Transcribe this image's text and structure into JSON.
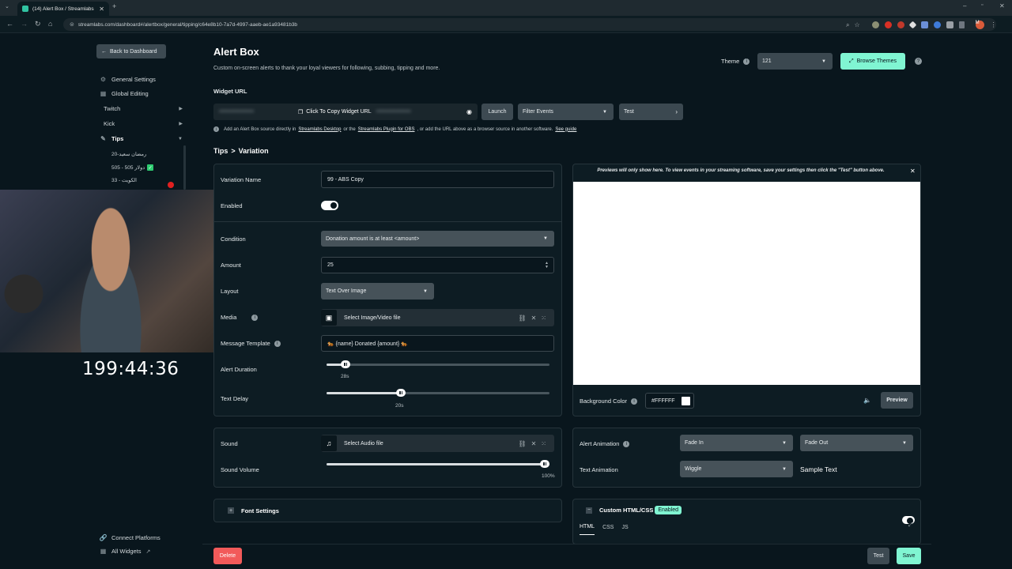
{
  "browser": {
    "tab_title": "(14) Alert Box / Streamlabs",
    "url": "streamlabs.com/dashboard#/alertbox/general/tipping/c64e8b10-7a7d-4997-aaeb-ae1a93481b3b",
    "profile_initial": "M"
  },
  "sidebar": {
    "back_label": "Back to Dashboard",
    "items": [
      {
        "label": "General Settings",
        "icon": "gear-icon"
      },
      {
        "label": "Global Editing",
        "icon": "grid-icon"
      },
      {
        "label": "Twitch"
      },
      {
        "label": "Kick"
      },
      {
        "label": "Tips",
        "icon": "coins-icon"
      }
    ],
    "tips_variations": [
      "20-رمضان سعيد",
      "505 - 505 دولار",
      "33 - الكويت"
    ],
    "bottom": [
      {
        "label": "Connect Platforms",
        "icon": "link-icon"
      },
      {
        "label": "All Widgets",
        "icon": "grid-icon"
      }
    ]
  },
  "webcam": {
    "timer": "199:44:36"
  },
  "header": {
    "title": "Alert Box",
    "subtitle": "Custom on-screen alerts to thank your loyal viewers for following, subbing, tipping and more.",
    "theme_label": "Theme",
    "theme_value": "121",
    "browse_themes": "Browse Themes"
  },
  "widget": {
    "url_label": "Widget URL",
    "copy_label": "Click To Copy Widget URL",
    "launch": "Launch",
    "filter_events": "Filter Events",
    "test": "Test",
    "info_parts": {
      "a": "Add an Alert Box source directly in",
      "b": "Streamlabs Desktop",
      "c": "or the",
      "d": "Streamlabs Plugin for OBS",
      "e": ", or add the URL above as a browser source in another software.",
      "f": "See guide"
    }
  },
  "breadcrumb": {
    "parent": "Tips",
    "sep": ">",
    "current": "Variation"
  },
  "variation": {
    "name_label": "Variation Name",
    "name_value": "99 - ABS Copy",
    "enabled_label": "Enabled",
    "condition_label": "Condition",
    "condition_value": "Donation amount is at least <amount>",
    "amount_label": "Amount",
    "amount_value": "25",
    "layout_label": "Layout",
    "layout_value": "Text Over Image",
    "media_label": "Media",
    "media_value": "Select Image/Video file",
    "template_label": "Message Template",
    "template_value": "🐅 {name} Donated {amount} 🐅",
    "duration_label": "Alert Duration",
    "duration_value": "28s",
    "duration_fraction": 0.085,
    "delay_label": "Text Delay",
    "delay_value": "20s",
    "delay_fraction": 0.335
  },
  "preview": {
    "notice": "Previews will only show here. To view events in your streaming software, save your settings then click the \"Test\" button above.",
    "bg_label": "Background Color",
    "bg_value": "#FFFFFF",
    "preview_btn": "Preview"
  },
  "sound": {
    "label": "Sound",
    "file": "Select Audio file",
    "volume_label": "Sound Volume",
    "volume_value": "100%",
    "volume_fraction": 1.0
  },
  "animation": {
    "alert_label": "Alert Animation",
    "in_value": "Fade In",
    "out_value": "Fade Out",
    "text_label": "Text Animation",
    "text_value": "Wiggle",
    "sample": "Sample Text"
  },
  "font": {
    "label": "Font Settings"
  },
  "custom": {
    "label": "Custom HTML/CSS",
    "badge": "Enabled",
    "tabs": [
      "HTML",
      "CSS",
      "JS"
    ]
  },
  "footer": {
    "delete": "Delete",
    "test": "Test",
    "save": "Save"
  },
  "colors": {
    "accent": "#80f5d2",
    "danger": "#f25a5a",
    "bg": "#09161d"
  }
}
